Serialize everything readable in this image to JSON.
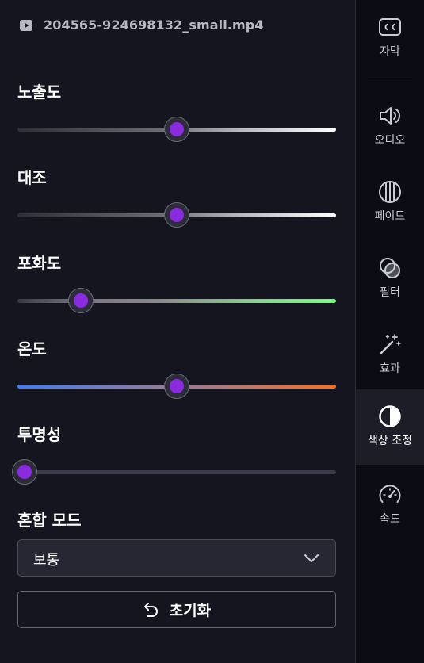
{
  "file": {
    "name": "204565-924698132_small.mp4",
    "icon": "video-file-icon"
  },
  "sliders": [
    {
      "label": "노출도",
      "value": 0.5,
      "gradient": "neutral"
    },
    {
      "label": "대조",
      "value": 0.5,
      "gradient": "neutral"
    },
    {
      "label": "포화도",
      "value": 0.2,
      "gradient": "saturation"
    },
    {
      "label": "온도",
      "value": 0.5,
      "gradient": "temperature"
    },
    {
      "label": "투명성",
      "value": 0.0,
      "gradient": "opacity"
    }
  ],
  "blend": {
    "label": "혼합 모드",
    "value": "보통"
  },
  "reset": {
    "label": "초기화",
    "icon": "undo-icon"
  },
  "sidebar": {
    "items": [
      {
        "label": "자막",
        "icon": "cc-icon"
      },
      {
        "label": "오디오",
        "icon": "speaker-icon"
      },
      {
        "label": "페이드",
        "icon": "fade-icon"
      },
      {
        "label": "필터",
        "icon": "filter-icon"
      },
      {
        "label": "효과",
        "icon": "magic-wand-icon"
      },
      {
        "label": "색상 조정",
        "icon": "contrast-icon",
        "active": true
      },
      {
        "label": "속도",
        "icon": "speedometer-icon"
      }
    ]
  },
  "colors": {
    "accent": "#8a2be2",
    "background": "#14151f",
    "sidebar": "#0c0d14"
  }
}
